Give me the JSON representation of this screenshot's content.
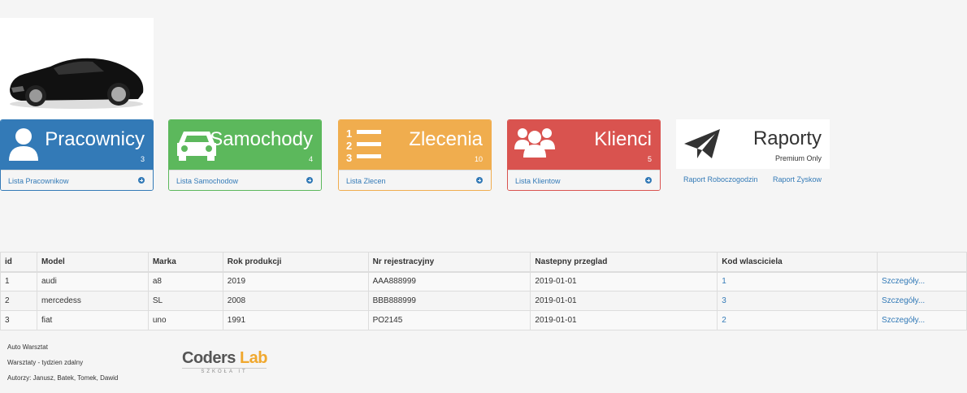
{
  "logo": {
    "alt": "car-image"
  },
  "panels": [
    {
      "title": "Pracownicy",
      "count": "3",
      "link": "Lista Pracownikow"
    },
    {
      "title": "Samochody",
      "count": "4",
      "link": "Lista Samochodow"
    },
    {
      "title": "Zlecenia",
      "count": "10",
      "link": "Lista Zlecen"
    },
    {
      "title": "Klienci",
      "count": "5",
      "link": "Lista Klientow"
    },
    {
      "title": "Raporty",
      "subtitle": "Premium Only",
      "link1": "Raport Roboczogodzin",
      "link2": "Raport Zyskow"
    }
  ],
  "table": {
    "headers": [
      "id",
      "Model",
      "Marka",
      "Rok produkcji",
      "Nr rejestracyjny",
      "Nastepny przeglad",
      "Kod wlasciciela",
      ""
    ],
    "rows": [
      [
        "1",
        "audi",
        "a8",
        "2019",
        "AAA888999",
        "2019-01-01",
        "1",
        "Szczegóły..."
      ],
      [
        "2",
        "mercedess",
        "SL",
        "2008",
        "BBB888999",
        "2019-01-01",
        "3",
        "Szczegóły..."
      ],
      [
        "3",
        "fiat",
        "uno",
        "1991",
        "PO2145",
        "2019-01-01",
        "2",
        "Szczegóły..."
      ]
    ]
  },
  "footer": {
    "line1": "Auto Warsztat",
    "line2": "Warsztaty - tydzien zdalny",
    "line3": "Autorzy: Janusz, Batek, Tomek, Dawid",
    "brand_a": "Coders ",
    "brand_b": "Lab",
    "brand_sub": "SZKOŁA IT"
  }
}
